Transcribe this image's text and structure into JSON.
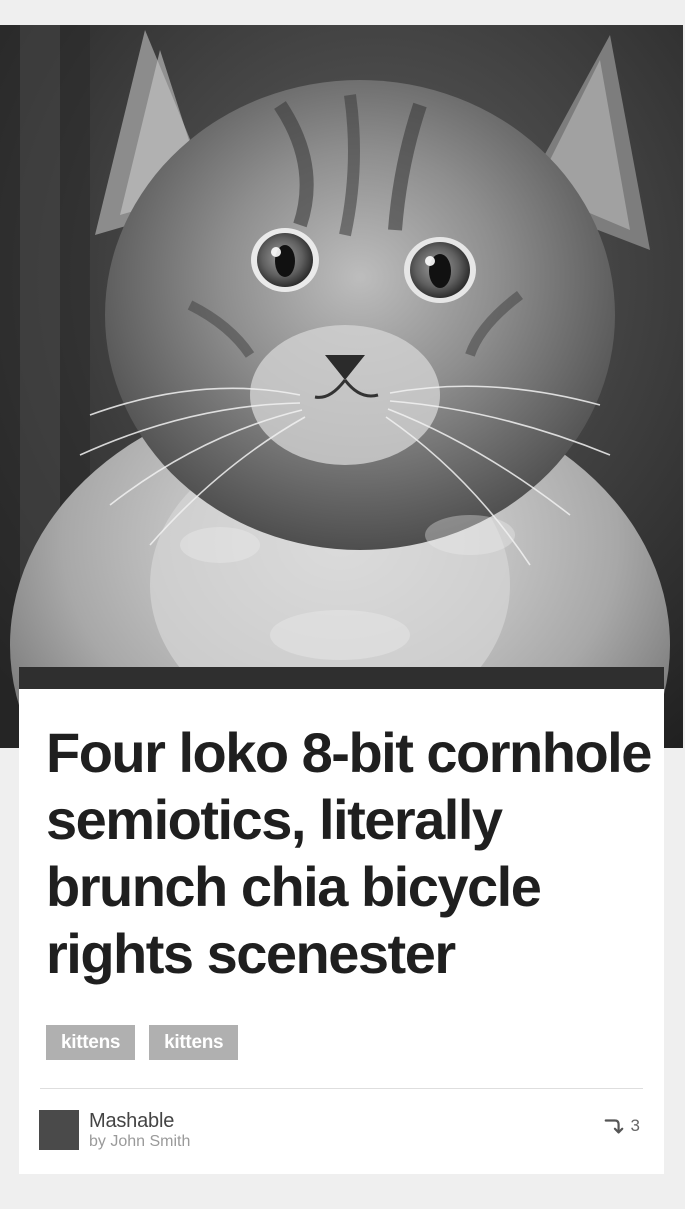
{
  "hero": {
    "image_icon": "kitten-photo"
  },
  "article": {
    "headline": "Four loko 8-bit cornhole semiotics, literally brunch chia bicycle rights scenester",
    "tags": [
      {
        "label": "kittens"
      },
      {
        "label": "kittens"
      }
    ]
  },
  "footer": {
    "source": "Mashable",
    "author": "by John Smith",
    "share_count": "3",
    "share_icon": "share-arrow-icon"
  },
  "colors": {
    "background": "#efefef",
    "card": "#ffffff",
    "headline": "#1f1f1f",
    "tag": "#b0b0b0",
    "avatar": "#4a4a4a"
  }
}
